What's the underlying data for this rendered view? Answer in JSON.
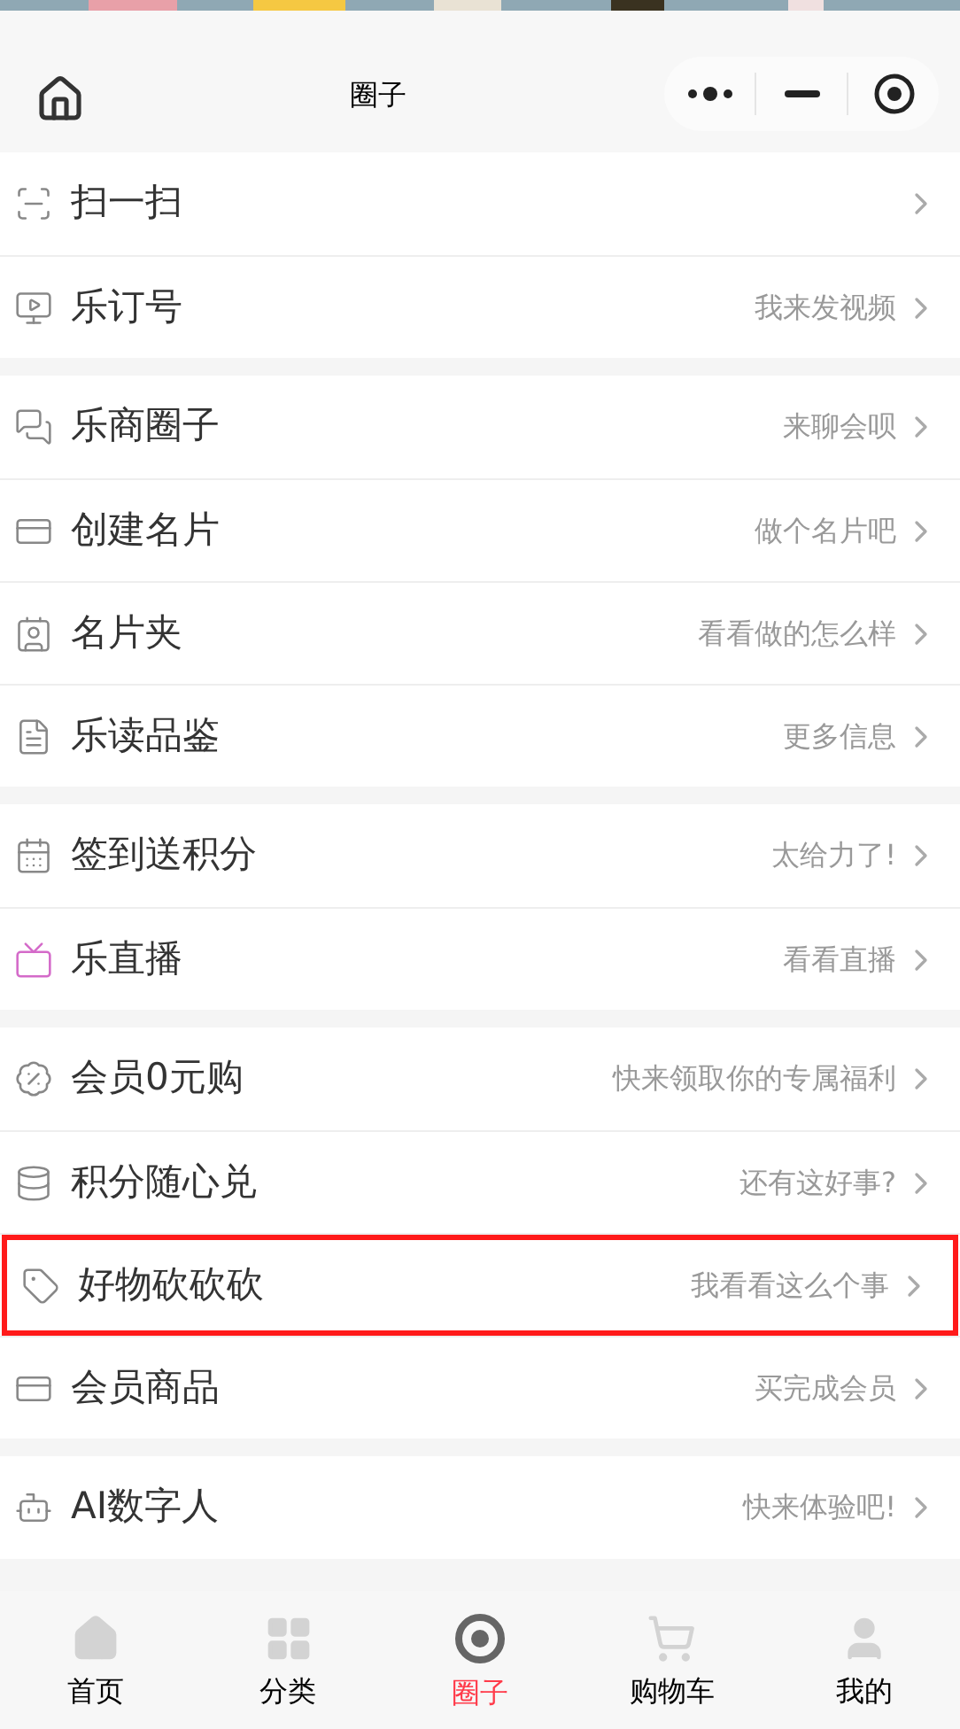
{
  "header": {
    "title": "圈子"
  },
  "groups": [
    {
      "items": [
        {
          "label": "扫一扫",
          "highlighted": false
        },
        {
          "label": "乐订号",
          "hint": "我来发视频",
          "highlighted": false
        }
      ]
    },
    {
      "items": [
        {
          "label": "乐商圈子",
          "hint": "来聊会呗",
          "highlighted": false
        },
        {
          "label": "创建名片",
          "hint": "做个名片吧",
          "highlighted": false
        },
        {
          "label": "名片夹",
          "hint": "看看做的怎么样",
          "highlighted": false
        },
        {
          "label": "乐读品鉴",
          "hint": "更多信息",
          "highlighted": false
        }
      ]
    },
    {
      "items": [
        {
          "label": "签到送积分",
          "hint": "太给力了!",
          "highlighted": false
        },
        {
          "label": "乐直播",
          "hint": "看看直播",
          "highlighted": false
        }
      ]
    },
    {
      "items": [
        {
          "label": "会员0元购",
          "hint": "快来领取你的专属福利",
          "highlighted": false
        },
        {
          "label": "积分随心兑",
          "hint": "还有这好事?",
          "highlighted": false
        },
        {
          "label": "好物砍砍砍",
          "hint": "我看看这么个事",
          "highlighted": true
        },
        {
          "label": "会员商品",
          "hint": "买完成会员",
          "highlighted": false
        }
      ]
    },
    {
      "items": [
        {
          "label": "AI数字人",
          "hint": "快来体验吧!",
          "highlighted": false
        }
      ]
    }
  ],
  "tabbar": [
    {
      "label": "首页",
      "selected": false
    },
    {
      "label": "分类",
      "selected": false
    },
    {
      "label": "圈子",
      "selected": true
    },
    {
      "label": "购物车",
      "selected": false
    },
    {
      "label": "我的",
      "selected": false
    }
  ]
}
